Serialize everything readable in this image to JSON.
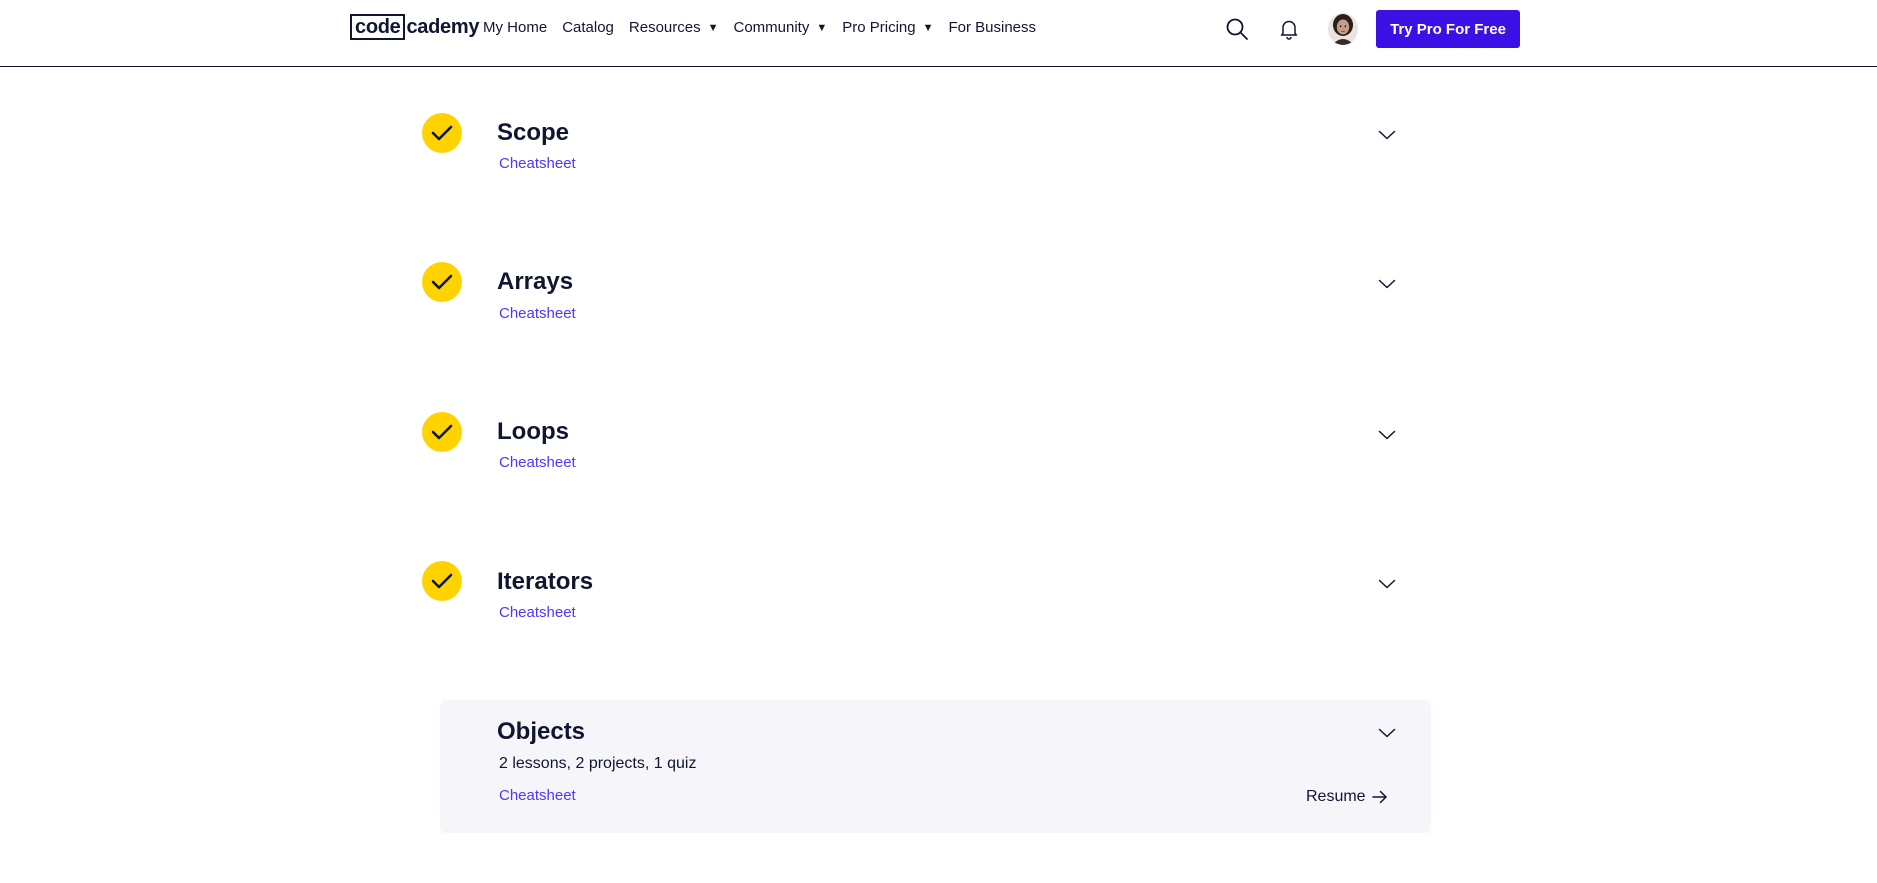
{
  "header": {
    "logo": {
      "boxed": "code",
      "rest": "cademy"
    },
    "nav": [
      {
        "label": "My Home",
        "has_caret": false
      },
      {
        "label": "Catalog",
        "has_caret": false
      },
      {
        "label": "Resources",
        "has_caret": true
      },
      {
        "label": "Community",
        "has_caret": true
      },
      {
        "label": "Pro Pricing",
        "has_caret": true
      },
      {
        "label": "For Business",
        "has_caret": false
      }
    ],
    "caret_glyph": "▼",
    "icons": {
      "search": "search-icon",
      "notifications": "bell-icon"
    },
    "cta_label": "Try Pro For Free"
  },
  "modules": [
    {
      "title": "Scope",
      "cheatsheet": "Cheatsheet",
      "completed": true
    },
    {
      "title": "Arrays",
      "cheatsheet": "Cheatsheet",
      "completed": true
    },
    {
      "title": "Loops",
      "cheatsheet": "Cheatsheet",
      "completed": true
    },
    {
      "title": "Iterators",
      "cheatsheet": "Cheatsheet",
      "completed": true
    }
  ],
  "current_module": {
    "title": "Objects",
    "meta": "2 lessons, 2 projects, 1 quiz",
    "cheatsheet": "Cheatsheet",
    "resume_label": "Resume"
  },
  "colors": {
    "brand": "#3a10e5",
    "link": "#5533ff",
    "complete": "#ffd300",
    "text": "#10162f",
    "card_bg": "#f5f5fa"
  }
}
